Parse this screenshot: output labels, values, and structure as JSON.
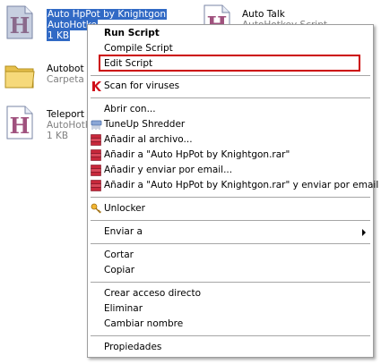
{
  "files": [
    {
      "name": "Auto HpPot by Knightgon",
      "type": "AutoHotkey Script",
      "size": "1 KB",
      "icon": "ahk-script-icon"
    },
    {
      "name": "Auto Talk",
      "type": "AutoHotkey Script",
      "icon": "ahk-script-icon"
    },
    {
      "name": "Autobot",
      "type": "Carpeta de archivos",
      "icon": "folder-icon"
    },
    {
      "name": "Teleport",
      "type": "AutoHotkey Script",
      "size": "1 KB",
      "icon": "ahk-script-icon"
    }
  ],
  "visible": {
    "file0_name": "Auto HpPot by Knightgon",
    "file0_type": "AutoHotke",
    "file0_size": "1 KB",
    "file1_name": "Auto Talk",
    "file1_type": "AutoHotkey Script",
    "file2_name": "Autobot",
    "file2_type": "Carpeta d",
    "file3_name": "Teleport",
    "file3_type": "AutoHotk",
    "file3_size": "1 KB"
  },
  "menu": {
    "items": [
      {
        "label": "Run Script",
        "bold": true
      },
      {
        "label": "Compile Script"
      },
      {
        "label": "Edit Script",
        "highlighted": true
      },
      {
        "label": "Scan for viruses",
        "icon": "kaspersky-icon"
      },
      {
        "label": "Abrir con..."
      },
      {
        "label": "TuneUp Shredder",
        "icon": "shredder-icon"
      },
      {
        "label": "Añadir al archivo...",
        "icon": "winrar-icon"
      },
      {
        "label": "Añadir a \"Auto HpPot by Knightgon.rar\"",
        "icon": "winrar-icon"
      },
      {
        "label": "Añadir y enviar por email...",
        "icon": "winrar-icon"
      },
      {
        "label": "Añadir a \"Auto HpPot by Knightgon.rar\" y enviar por email",
        "icon": "winrar-icon"
      },
      {
        "label": "Unlocker",
        "icon": "unlocker-icon"
      },
      {
        "label": "Enviar a",
        "submenu": true
      },
      {
        "label": "Cortar"
      },
      {
        "label": "Copiar"
      },
      {
        "label": "Crear acceso directo"
      },
      {
        "label": "Eliminar"
      },
      {
        "label": "Cambiar nombre"
      },
      {
        "label": "Propiedades"
      }
    ]
  },
  "colors": {
    "selection": "#316ac5",
    "highlight_box": "#cc0000",
    "ahk_letter": "#a0527e"
  }
}
